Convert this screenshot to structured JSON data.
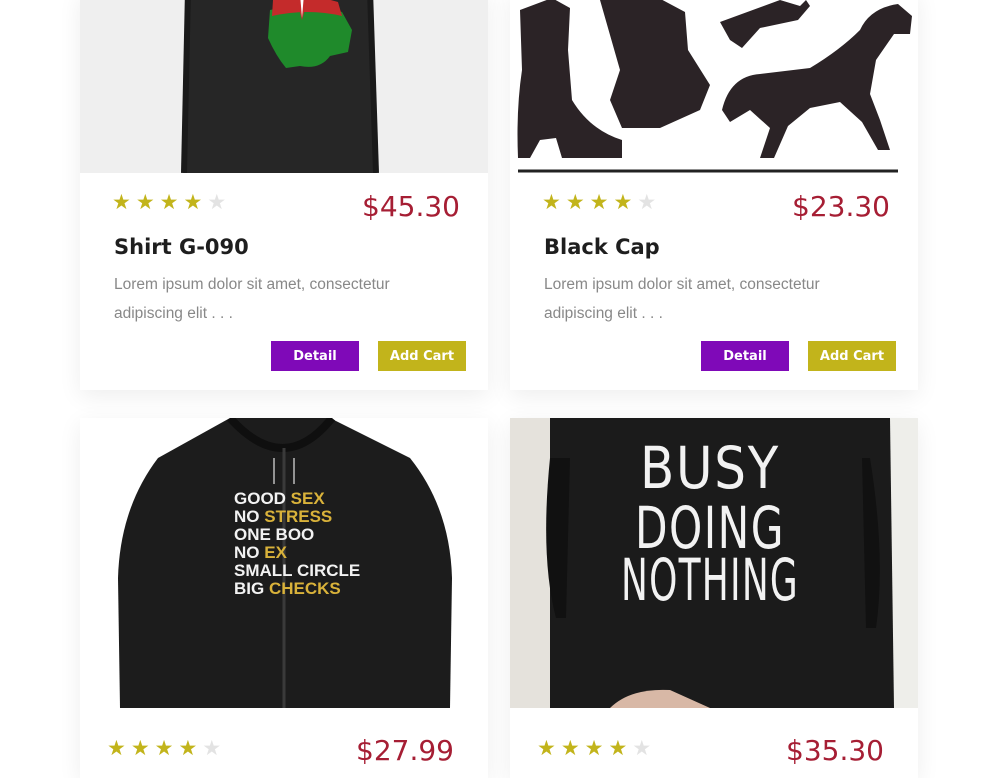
{
  "colors": {
    "accent_purple": "#7f09b8",
    "accent_olive": "#c2b41b",
    "price_red": "#a61e34",
    "star_off": "#e3e3e3"
  },
  "products": [
    {
      "title": "Shirt G-090",
      "price": "$45.30",
      "rating": 4,
      "rating_max": 5,
      "description": "Lorem ipsum dolor sit amet, consectetur adipiscing elit . . .",
      "detail_label": "Detail",
      "cart_label": "Add Cart"
    },
    {
      "title": "Black Cap",
      "price": "$23.30",
      "rating": 4,
      "rating_max": 5,
      "description": "Lorem ipsum dolor sit amet, consectetur adipiscing elit . . .",
      "detail_label": "Detail",
      "cart_label": "Add Cart"
    },
    {
      "price": "$27.99",
      "rating": 4,
      "rating_max": 5,
      "shirt_text": [
        {
          "a": "GOOD ",
          "b": "SEX"
        },
        {
          "a": "NO ",
          "b": "STRESS"
        },
        {
          "a": "ONE BOO",
          "b": ""
        },
        {
          "a": "NO ",
          "b": "EX"
        },
        {
          "a": "SMALL CIRCLE",
          "b": ""
        },
        {
          "a": "BIG ",
          "b": "CHECKS"
        }
      ]
    },
    {
      "price": "$35.30",
      "rating": 4,
      "rating_max": 5,
      "shirt_text": [
        "BUSY",
        "DOING",
        "NOTHING"
      ]
    }
  ]
}
